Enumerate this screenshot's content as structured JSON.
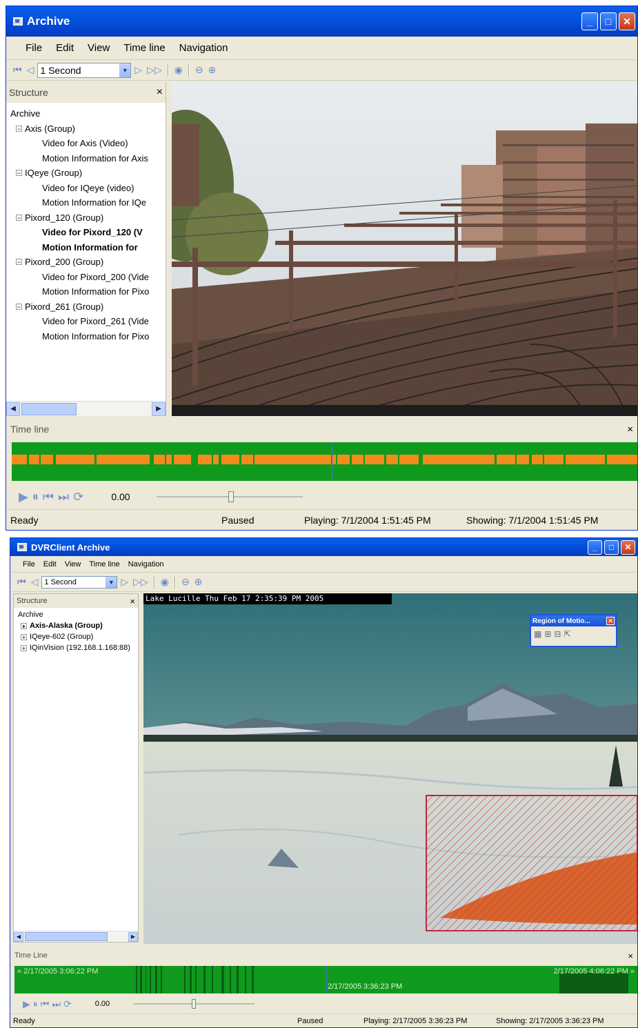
{
  "win1": {
    "title": "Archive",
    "menu": [
      "File",
      "Edit",
      "View",
      "Time line",
      "Navigation"
    ],
    "interval": "1 Second",
    "structure_title": "Structure",
    "close_glyph": "×",
    "tree": [
      {
        "text": "Archive",
        "expander": ""
      },
      {
        "text": "Axis (Group)",
        "expander": "−"
      },
      {
        "text": "Video for Axis (Video)",
        "expander": ""
      },
      {
        "text": "Motion Information for Axis",
        "expander": ""
      },
      {
        "text": "IQeye (Group)",
        "expander": "−"
      },
      {
        "text": "Video for IQeye (video)",
        "expander": ""
      },
      {
        "text": "Motion Information for IQe",
        "expander": ""
      },
      {
        "text": "Pixord_120 (Group)",
        "expander": "−"
      },
      {
        "text": "Video for Pixord_120 (V",
        "expander": "",
        "bold": true
      },
      {
        "text": "Motion Information for",
        "expander": "",
        "bold": true
      },
      {
        "text": "Pixord_200 (Group)",
        "expander": "−"
      },
      {
        "text": "Video for Pixord_200 (Vide",
        "expander": ""
      },
      {
        "text": "Motion Information for Pixo",
        "expander": ""
      },
      {
        "text": "Pixord_261 (Group)",
        "expander": "−"
      },
      {
        "text": "Video for Pixord_261 (Vide",
        "expander": ""
      },
      {
        "text": "Motion Information for Pixo",
        "expander": ""
      }
    ],
    "timeline_title": "Time line",
    "time_value": "0.00",
    "status": {
      "ready": "Ready",
      "state": "Paused",
      "playing": "Playing: 7/1/2004 1:51:45 PM",
      "showing": "Showing: 7/1/2004 1:51:45 PM"
    }
  },
  "win2": {
    "title": "DVRClient Archive",
    "menu": [
      "File",
      "Edit",
      "View",
      "Time line",
      "Navigation"
    ],
    "interval": "1 Second",
    "structure_title": "Structure",
    "close_glyph": "×",
    "tree": [
      {
        "text": "Archive",
        "expander": ""
      },
      {
        "text": "Axis-Alaska (Group)",
        "expander": "+",
        "bold": true
      },
      {
        "text": "IQeye-602 (Group)",
        "expander": "+"
      },
      {
        "text": "IQinVision (192.168.1.168:88)",
        "expander": "+"
      }
    ],
    "overlay_caption": "Lake Lucille  Thu Feb 17  2:35:39 PM 2005",
    "region_title": "Region of Motio...",
    "timeline_title": "Time Line",
    "tl_start": "« 2/17/2005 3:06:22 PM",
    "tl_end": "2/17/2005 4:06:22 PM »",
    "tl_current": "2/17/2005 3:36:23 PM",
    "time_value": "0.00",
    "status": {
      "ready": "Ready",
      "state": "Paused",
      "playing": "Playing: 2/17/2005 3:36:23 PM",
      "showing": "Showing: 2/17/2005 3:36:23 PM"
    }
  },
  "icons": [
    "rewind-icon",
    "step-back-icon",
    "step-forward-icon",
    "fast-forward-icon",
    "camera-icon",
    "zoom-out-icon",
    "zoom-in-icon",
    "play-icon",
    "pause-icon",
    "skip-start-icon",
    "skip-end-icon",
    "refresh-icon"
  ]
}
